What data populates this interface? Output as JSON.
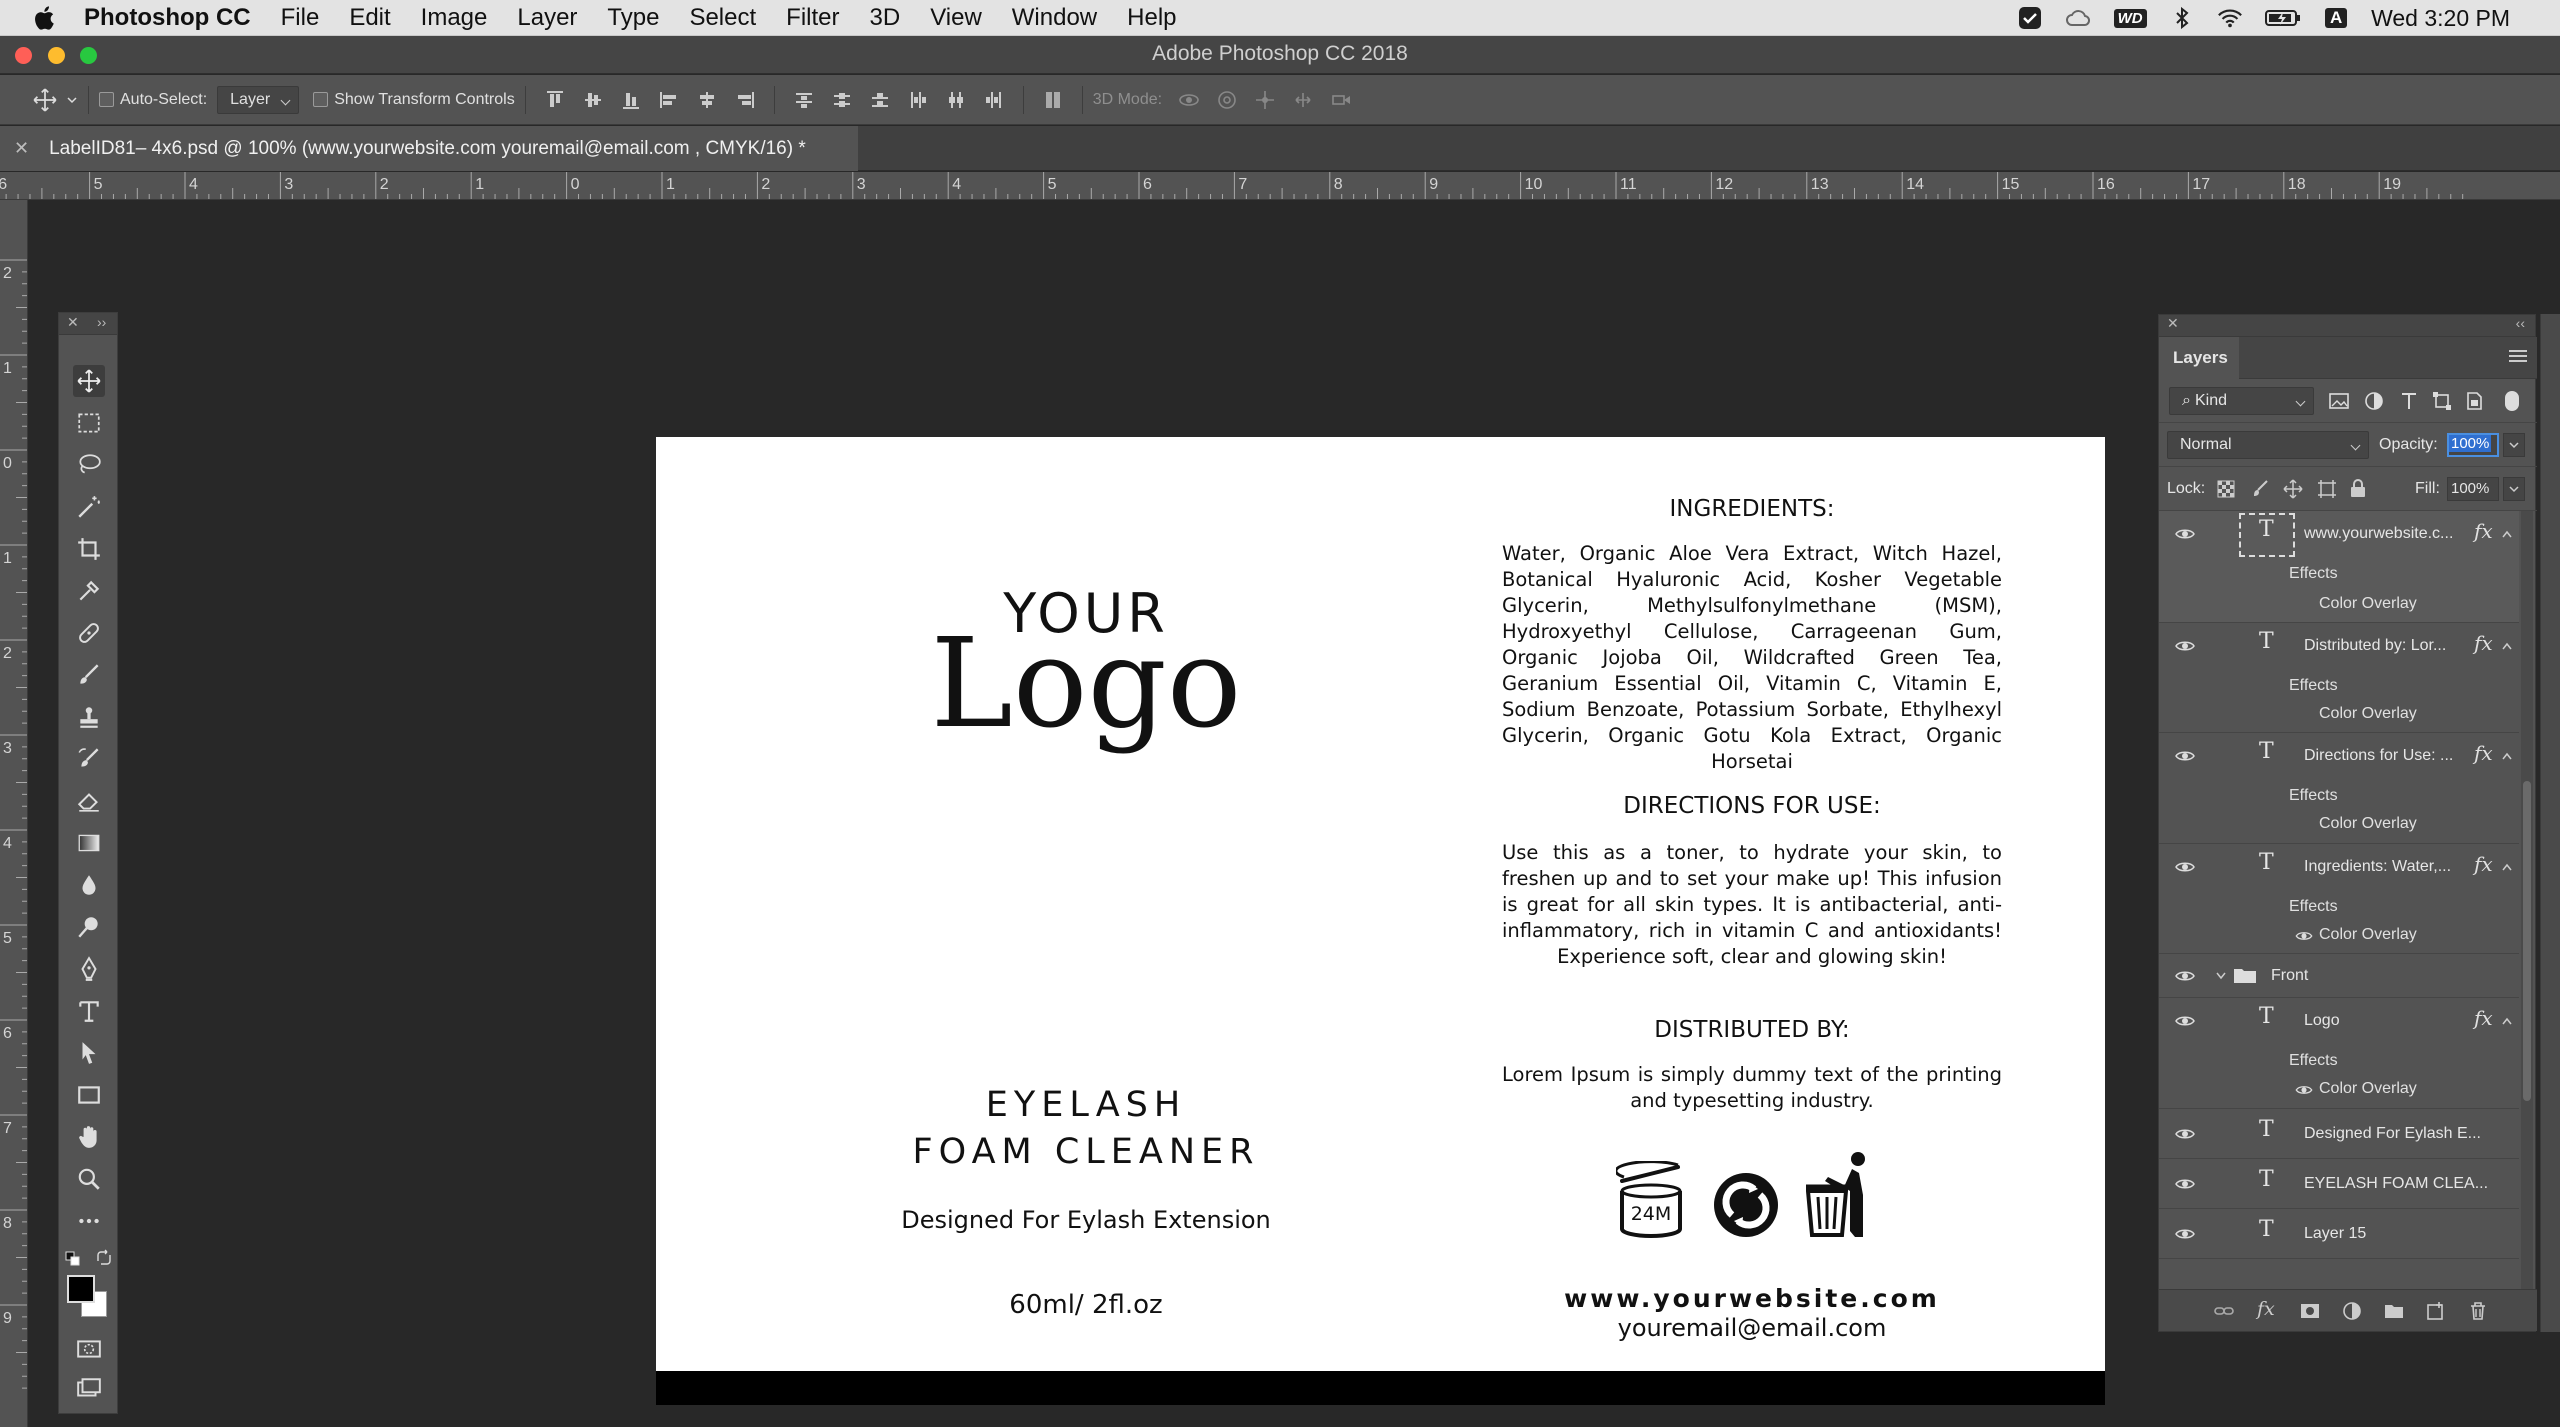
{
  "menubar": {
    "app": "Photoshop CC",
    "items": [
      "File",
      "Edit",
      "Image",
      "Layer",
      "Type",
      "Select",
      "Filter",
      "3D",
      "View",
      "Window",
      "Help"
    ],
    "clock": "Wed 3:20 PM",
    "wd_badge": "WD",
    "input_badge": "A"
  },
  "titlebar": {
    "title": "Adobe Photoshop CC 2018"
  },
  "options": {
    "auto_select_label": "Auto-Select:",
    "auto_select_value": "Layer",
    "transform_label": "Show Transform Controls",
    "mode_3d_label": "3D Mode:"
  },
  "document": {
    "tab_title": "LabelID81– 4x6.psd @ 100% (www.yourwebsite.com youremail@email.com , CMYK/16) *"
  },
  "ruler": {
    "h_labels": [
      "6",
      "5",
      "4",
      "3",
      "2",
      "1",
      "0",
      "1",
      "2",
      "3",
      "4",
      "5",
      "6",
      "7",
      "8",
      "9",
      "10",
      "11",
      "12",
      "13",
      "14",
      "15",
      "16",
      "17",
      "18",
      "19"
    ],
    "v_labels": [
      "2",
      "1",
      "0",
      "1",
      "2",
      "3",
      "4",
      "5",
      "6",
      "7",
      "8",
      "9"
    ]
  },
  "label": {
    "logo_top": "YOUR",
    "logo_main": "Logo",
    "product_line1": "EYELASH",
    "product_line2": "FOAM CLEANER",
    "tagline": "Designed For Eylash Extension",
    "volume": "60ml/ 2fl.oz",
    "ingredients_title": "INGREDIENTS:",
    "ingredients_text": "Water, Organic Aloe Vera Extract, Witch Hazel, Botanical Hyaluronic Acid, Kosher Vegetable Glycerin, Methylsulfonylmethane (MSM), Hydroxyethyl Cellulose, Carrageenan Gum, Organic Jojoba Oil, Wildcrafted Green Tea, Geranium Essential Oil, Vitamin C, Vitamin E, Sodium Benzoate, Potassium Sorbate, Ethylhexyl Glycerin, Organic Gotu Kola Extract, Organic Horsetai",
    "directions_title": "DIRECTIONS FOR USE:",
    "directions_text": "Use this as a toner, to hydrate your skin, to freshen up and to set your make up! This infusion is great for all skin types. It is antibacterial, anti-inflammatory, rich in vitamin C and antioxidants! Experience soft, clear and glowing skin!",
    "distributed_title": "DISTRIBUTED BY:",
    "distributed_text": "Lorem Ipsum is simply dummy text of the printing and typesetting industry.",
    "jar_label": "24M",
    "website": "www.yourwebsite.com",
    "email": "youremail@email.com"
  },
  "layers_panel": {
    "title": "Layers",
    "filter_kind": "Kind",
    "blend_mode": "Normal",
    "opacity_label": "Opacity:",
    "opacity_value": "100%",
    "lock_label": "Lock:",
    "fill_label": "Fill:",
    "fill_value": "100%",
    "effects_label": "Effects",
    "color_overlay_label": "Color Overlay",
    "fx_label": "fx",
    "layers": [
      "www.yourwebsite.c...",
      "Distributed by:  Lor...",
      "Directions for Use: ...",
      "Ingredients:  Water,...",
      "Front",
      "Logo",
      "Designed For Eylash E...",
      "EYELASH FOAM CLEA...",
      "Layer 15"
    ]
  }
}
